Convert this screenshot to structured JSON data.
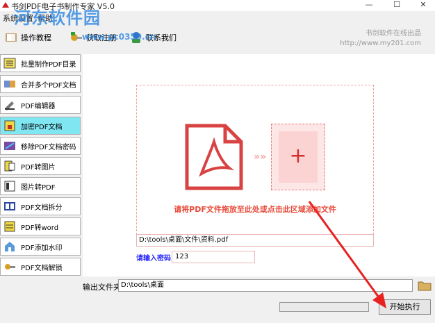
{
  "window": {
    "title": "书剑PDF电子书制作专家 V5.0",
    "minimize": "—",
    "maximize": "☐",
    "close": "✕"
  },
  "menu": {
    "items": [
      "系统设置",
      "帮助"
    ]
  },
  "watermark": {
    "text": "河东软件园",
    "url": "www.pc0359.cn"
  },
  "toolbar": {
    "buttons": [
      {
        "label": "操作教程",
        "icon": "book-icon"
      },
      {
        "label": "获取注册",
        "icon": "key-icon"
      },
      {
        "label": "联系我们",
        "icon": "contact-icon"
      }
    ],
    "brand_line1": "书剑软件在线出品",
    "brand_line2": "http://www.my201.com"
  },
  "sidebar": {
    "active_index": 3,
    "items": [
      {
        "label": "批量制作PDF目录",
        "icon": "toc-icon"
      },
      {
        "label": "合并多个PDF文档",
        "icon": "merge-icon"
      },
      {
        "label": "PDF编辑器",
        "icon": "edit-icon"
      },
      {
        "label": "加密PDF文档",
        "icon": "encrypt-icon"
      },
      {
        "label": "移除PDF文档密码",
        "icon": "remove-password-icon"
      },
      {
        "label": "PDF转图片",
        "icon": "pdf-to-image-icon"
      },
      {
        "label": "图片转PDF",
        "icon": "image-to-pdf-icon"
      },
      {
        "label": "PDF文档拆分",
        "icon": "split-icon"
      },
      {
        "label": "PDF转word",
        "icon": "pdf-to-word-icon"
      },
      {
        "label": "PDF添加水印",
        "icon": "watermark-icon"
      },
      {
        "label": "PDF文档解锁",
        "icon": "unlock-icon"
      }
    ]
  },
  "main": {
    "arrows": "»»",
    "add_symbol": "+",
    "drop_hint": "请将PDF文件拖放至此处或点击此区域添加文件",
    "file_path": "D:\\tools\\桌面\\文件\\资料.pdf",
    "password_label": "请输入密码",
    "password_value": "123"
  },
  "output": {
    "label": "输出文件夹",
    "path": "D:\\tools\\桌面"
  },
  "progress": {
    "value": 0
  },
  "start_button": "开始执行",
  "colors": {
    "accent_red": "#d03030",
    "active_sidebar": "#7fe6f2",
    "password_blue": "#2a2aff",
    "watermark_blue": "#1f7fe0"
  }
}
